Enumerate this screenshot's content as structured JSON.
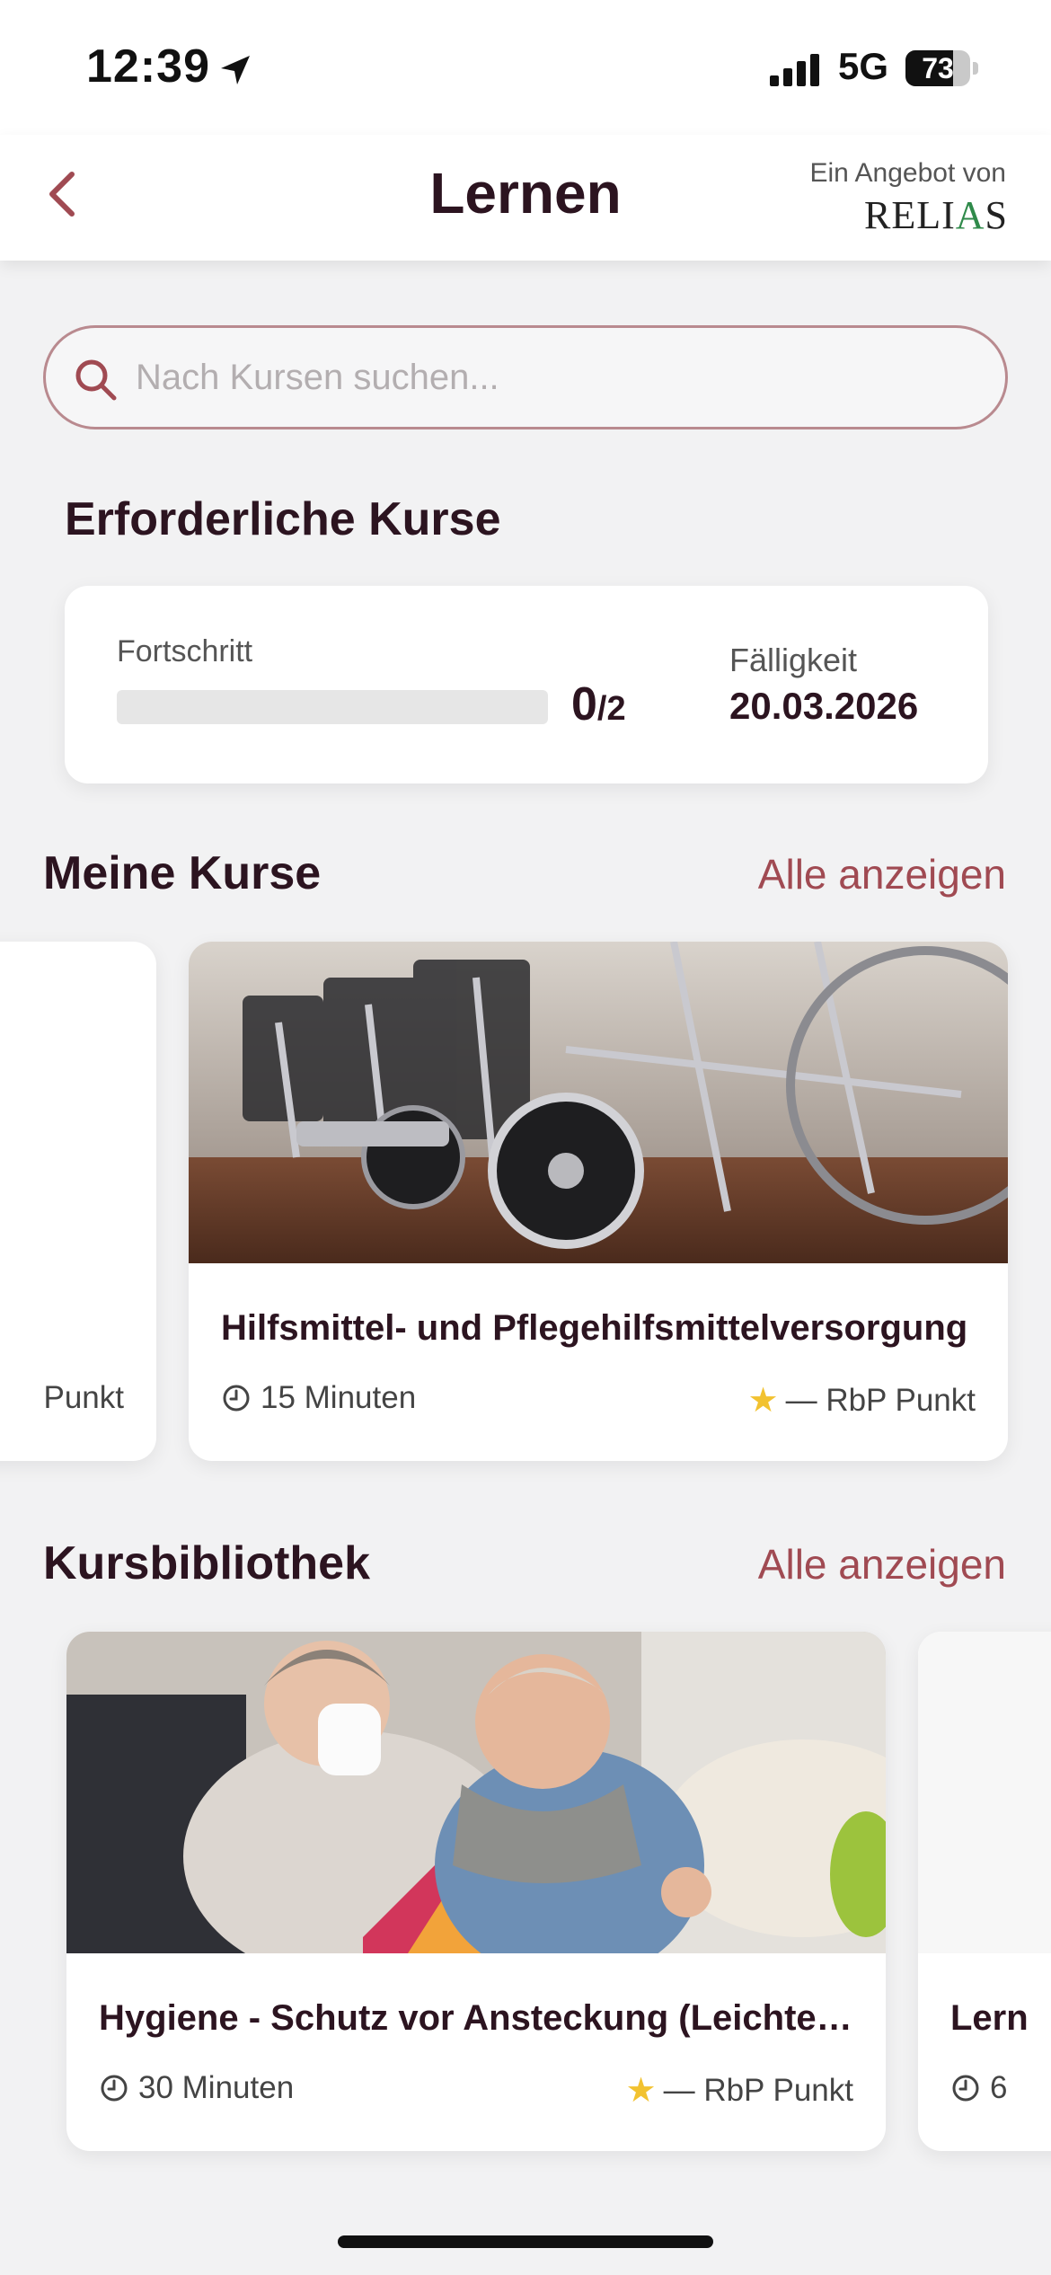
{
  "status_bar": {
    "time": "12:39",
    "network": "5G",
    "battery": "73"
  },
  "header": {
    "title": "Lernen",
    "brand_tagline": "Ein Angebot von",
    "brand_logo_prefix": "RELI",
    "brand_logo_accent": "A",
    "brand_logo_suffix": "S"
  },
  "search": {
    "placeholder": "Nach Kursen suchen..."
  },
  "required_courses": {
    "heading": "Erforderliche Kurse",
    "progress_label": "Fortschritt",
    "progress_done": "0",
    "progress_total": "/2",
    "progress_fraction": 0,
    "due_label": "Fälligkeit",
    "due_date": "20.03.2026"
  },
  "my_courses": {
    "heading": "Meine Kurse",
    "link": "Alle anzeigen",
    "cards": [
      {
        "title": "",
        "duration": "",
        "points": "Punkt"
      },
      {
        "title": "Hilfsmittel- und Pflegehilfsmittelversorgung",
        "duration": "15 Minuten",
        "points": "— RbP Punkt"
      }
    ]
  },
  "library": {
    "heading": "Kursbibliothek",
    "link": "Alle anzeigen",
    "cards": [
      {
        "title": "Hygiene - Schutz vor Ansteckung (Leichte Sprache)",
        "duration": "30 Minuten",
        "points": "— RbP Punkt"
      },
      {
        "title": "Lern",
        "duration": "6",
        "points": ""
      }
    ]
  },
  "colors": {
    "accent": "#a04a52",
    "heading": "#2c1420",
    "background": "#f2f2f3",
    "star": "#f2c230",
    "brand_green": "#2f8a4a"
  }
}
